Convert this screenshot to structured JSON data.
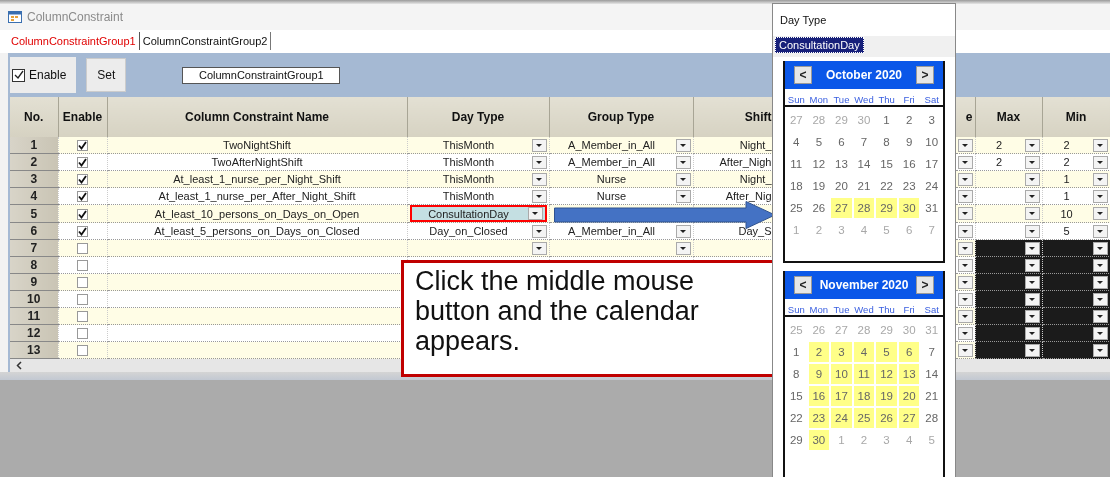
{
  "window": {
    "title": "ColumnConstraint"
  },
  "tabs": [
    {
      "label": "ColumnConstraintGroup1",
      "selected": true
    },
    {
      "label": "ColumnConstraintGroup2",
      "selected": false
    }
  ],
  "toolbar": {
    "enable": {
      "label": "Enable",
      "checked": true
    },
    "set_button": "Set",
    "group_name": "ColumnConstraintGroup1"
  },
  "table": {
    "columns": [
      {
        "label": "No."
      },
      {
        "label": "Enable"
      },
      {
        "label": "Column Constraint Name"
      },
      {
        "label": "Day Type"
      },
      {
        "label": "Group Type"
      },
      {
        "label": "Shift"
      },
      {
        "label": "e"
      },
      {
        "label": "Max"
      },
      {
        "label": "Min"
      }
    ],
    "rows": [
      {
        "no": "1",
        "enabled": true,
        "name": "TwoNightShift",
        "day_type": "ThisMonth",
        "group_type": "A_Member_in_All",
        "shift": "Night_",
        "max": "2",
        "min": "2",
        "type_dropdowns": true,
        "group_dropdown": true,
        "editing": false,
        "limits_blank": false
      },
      {
        "no": "2",
        "enabled": true,
        "name": "TwoAfterNightShift",
        "day_type": "ThisMonth",
        "group_type": "A_Member_in_All",
        "shift": "After_Nigh",
        "max": "2",
        "min": "2",
        "type_dropdowns": true,
        "group_dropdown": true,
        "editing": false,
        "limits_blank": false
      },
      {
        "no": "3",
        "enabled": true,
        "name": "At_least_1_nurse_per_Night_Shift",
        "day_type": "ThisMonth",
        "group_type": "Nurse",
        "shift": "Night_",
        "min": "1",
        "type_dropdowns": true,
        "group_dropdown": true,
        "editing": false,
        "limits_blank": false
      },
      {
        "no": "4",
        "enabled": true,
        "name": "At_least_1_nurse_per_After_Night_Shift",
        "day_type": "ThisMonth",
        "group_type": "Nurse",
        "shift": "After_Nig",
        "min": "1",
        "type_dropdowns": true,
        "group_dropdown": true,
        "editing": false,
        "limits_blank": false
      },
      {
        "no": "5",
        "enabled": true,
        "name": "At_least_10_persons_on_Days_on_Open",
        "day_type": "ConsultationDay",
        "min": "10",
        "type_dropdowns": true,
        "group_dropdown": false,
        "editing": true,
        "limits_blank": false
      },
      {
        "no": "6",
        "enabled": true,
        "name": "At_least_5_persons_on_Days_on_Closed",
        "day_type": "Day_on_Closed",
        "group_type": "A_Member_in_All",
        "shift": "Day_S",
        "min": "5",
        "type_dropdowns": true,
        "group_dropdown": true,
        "editing": false,
        "limits_blank": false
      },
      {
        "no": "7",
        "enabled": false,
        "type_dropdowns": true,
        "group_dropdown": true,
        "editing": false,
        "limits_blank": true
      },
      {
        "no": "8",
        "enabled": false,
        "type_dropdowns": false,
        "group_dropdown": false,
        "editing": false,
        "limits_blank": true
      },
      {
        "no": "9",
        "enabled": false,
        "type_dropdowns": false,
        "group_dropdown": false,
        "editing": false,
        "limits_blank": true
      },
      {
        "no": "10",
        "enabled": false,
        "type_dropdowns": false,
        "group_dropdown": false,
        "editing": false,
        "limits_blank": true
      },
      {
        "no": "11",
        "enabled": false,
        "type_dropdowns": false,
        "group_dropdown": false,
        "editing": false,
        "limits_blank": true
      },
      {
        "no": "12",
        "enabled": false,
        "type_dropdowns": false,
        "group_dropdown": false,
        "editing": false,
        "limits_blank": true
      },
      {
        "no": "13",
        "enabled": false,
        "type_dropdowns": false,
        "group_dropdown": false,
        "editing": false,
        "limits_blank": true
      }
    ]
  },
  "callout": {
    "text": "Click the middle mouse button and the calendar appears."
  },
  "popup": {
    "title": "Day Type",
    "selected_item": "ConsultationDay",
    "calendars": [
      {
        "month": "October 2020",
        "prev": "<",
        "next": ">",
        "weekdays": [
          "Sun",
          "Mon",
          "Tue",
          "Wed",
          "Thu",
          "Fri",
          "Sat"
        ],
        "weeks": [
          [
            {
              "d": "27",
              "muted": true,
              "highlighted": false
            },
            {
              "d": "28",
              "muted": true,
              "highlighted": false
            },
            {
              "d": "29",
              "muted": true,
              "highlighted": false
            },
            {
              "d": "30",
              "muted": true,
              "highlighted": false
            },
            {
              "d": "1",
              "muted": false,
              "highlighted": false
            },
            {
              "d": "2",
              "muted": false,
              "highlighted": false
            },
            {
              "d": "3",
              "muted": false,
              "highlighted": false
            }
          ],
          [
            {
              "d": "4",
              "muted": false,
              "highlighted": false
            },
            {
              "d": "5",
              "muted": false,
              "highlighted": false
            },
            {
              "d": "6",
              "muted": false,
              "highlighted": false
            },
            {
              "d": "7",
              "muted": false,
              "highlighted": false
            },
            {
              "d": "8",
              "muted": false,
              "highlighted": false
            },
            {
              "d": "9",
              "muted": false,
              "highlighted": false
            },
            {
              "d": "10",
              "muted": false,
              "highlighted": false
            }
          ],
          [
            {
              "d": "11",
              "muted": false,
              "highlighted": false
            },
            {
              "d": "12",
              "muted": false,
              "highlighted": false
            },
            {
              "d": "13",
              "muted": false,
              "highlighted": false
            },
            {
              "d": "14",
              "muted": false,
              "highlighted": false
            },
            {
              "d": "15",
              "muted": false,
              "highlighted": false
            },
            {
              "d": "16",
              "muted": false,
              "highlighted": false
            },
            {
              "d": "17",
              "muted": false,
              "highlighted": false
            }
          ],
          [
            {
              "d": "18",
              "muted": false,
              "highlighted": false
            },
            {
              "d": "19",
              "muted": false,
              "highlighted": false
            },
            {
              "d": "20",
              "muted": false,
              "highlighted": false
            },
            {
              "d": "21",
              "muted": false,
              "highlighted": false
            },
            {
              "d": "22",
              "muted": false,
              "highlighted": false
            },
            {
              "d": "23",
              "muted": false,
              "highlighted": false
            },
            {
              "d": "24",
              "muted": false,
              "highlighted": false
            }
          ],
          [
            {
              "d": "25",
              "muted": false,
              "highlighted": false
            },
            {
              "d": "26",
              "muted": false,
              "highlighted": false
            },
            {
              "d": "27",
              "muted": false,
              "highlighted": true
            },
            {
              "d": "28",
              "muted": false,
              "highlighted": true
            },
            {
              "d": "29",
              "muted": false,
              "highlighted": true
            },
            {
              "d": "30",
              "muted": false,
              "highlighted": true
            },
            {
              "d": "31",
              "muted": false,
              "highlighted": false
            }
          ],
          [
            {
              "d": "1",
              "muted": true,
              "highlighted": false
            },
            {
              "d": "2",
              "muted": true,
              "highlighted": false
            },
            {
              "d": "3",
              "muted": true,
              "highlighted": false
            },
            {
              "d": "4",
              "muted": true,
              "highlighted": false
            },
            {
              "d": "5",
              "muted": true,
              "highlighted": false
            },
            {
              "d": "6",
              "muted": true,
              "highlighted": false
            },
            {
              "d": "7",
              "muted": true,
              "highlighted": false
            }
          ]
        ]
      },
      {
        "month": "November 2020",
        "prev": "<",
        "next": ">",
        "weekdays": [
          "Sun",
          "Mon",
          "Tue",
          "Wed",
          "Thu",
          "Fri",
          "Sat"
        ],
        "weeks": [
          [
            {
              "d": "25",
              "muted": true,
              "highlighted": false
            },
            {
              "d": "26",
              "muted": true,
              "highlighted": false
            },
            {
              "d": "27",
              "muted": true,
              "highlighted": false
            },
            {
              "d": "28",
              "muted": true,
              "highlighted": false
            },
            {
              "d": "29",
              "muted": true,
              "highlighted": false
            },
            {
              "d": "30",
              "muted": true,
              "highlighted": false
            },
            {
              "d": "31",
              "muted": true,
              "highlighted": false
            }
          ],
          [
            {
              "d": "1",
              "muted": false,
              "highlighted": false
            },
            {
              "d": "2",
              "muted": false,
              "highlighted": true
            },
            {
              "d": "3",
              "muted": false,
              "highlighted": true
            },
            {
              "d": "4",
              "muted": false,
              "highlighted": true
            },
            {
              "d": "5",
              "muted": false,
              "highlighted": true
            },
            {
              "d": "6",
              "muted": false,
              "highlighted": true
            },
            {
              "d": "7",
              "muted": false,
              "highlighted": false
            }
          ],
          [
            {
              "d": "8",
              "muted": false,
              "highlighted": false
            },
            {
              "d": "9",
              "muted": false,
              "highlighted": true
            },
            {
              "d": "10",
              "muted": false,
              "highlighted": true
            },
            {
              "d": "11",
              "muted": false,
              "highlighted": true
            },
            {
              "d": "12",
              "muted": false,
              "highlighted": true
            },
            {
              "d": "13",
              "muted": false,
              "highlighted": true
            },
            {
              "d": "14",
              "muted": false,
              "highlighted": false
            }
          ],
          [
            {
              "d": "15",
              "muted": false,
              "highlighted": false
            },
            {
              "d": "16",
              "muted": false,
              "highlighted": true
            },
            {
              "d": "17",
              "muted": false,
              "highlighted": true
            },
            {
              "d": "18",
              "muted": false,
              "highlighted": true
            },
            {
              "d": "19",
              "muted": false,
              "highlighted": true
            },
            {
              "d": "20",
              "muted": false,
              "highlighted": true
            },
            {
              "d": "21",
              "muted": false,
              "highlighted": false
            }
          ],
          [
            {
              "d": "22",
              "muted": false,
              "highlighted": false
            },
            {
              "d": "23",
              "muted": false,
              "highlighted": true
            },
            {
              "d": "24",
              "muted": false,
              "highlighted": true
            },
            {
              "d": "25",
              "muted": false,
              "highlighted": true
            },
            {
              "d": "26",
              "muted": false,
              "highlighted": true
            },
            {
              "d": "27",
              "muted": false,
              "highlighted": true
            },
            {
              "d": "28",
              "muted": false,
              "highlighted": false
            }
          ],
          [
            {
              "d": "29",
              "muted": false,
              "highlighted": false
            },
            {
              "d": "30",
              "muted": false,
              "highlighted": true
            },
            {
              "d": "1",
              "muted": true,
              "highlighted": false
            },
            {
              "d": "2",
              "muted": true,
              "highlighted": false
            },
            {
              "d": "3",
              "muted": true,
              "highlighted": false
            },
            {
              "d": "4",
              "muted": true,
              "highlighted": false
            },
            {
              "d": "5",
              "muted": true,
              "highlighted": false
            }
          ]
        ]
      }
    ]
  }
}
